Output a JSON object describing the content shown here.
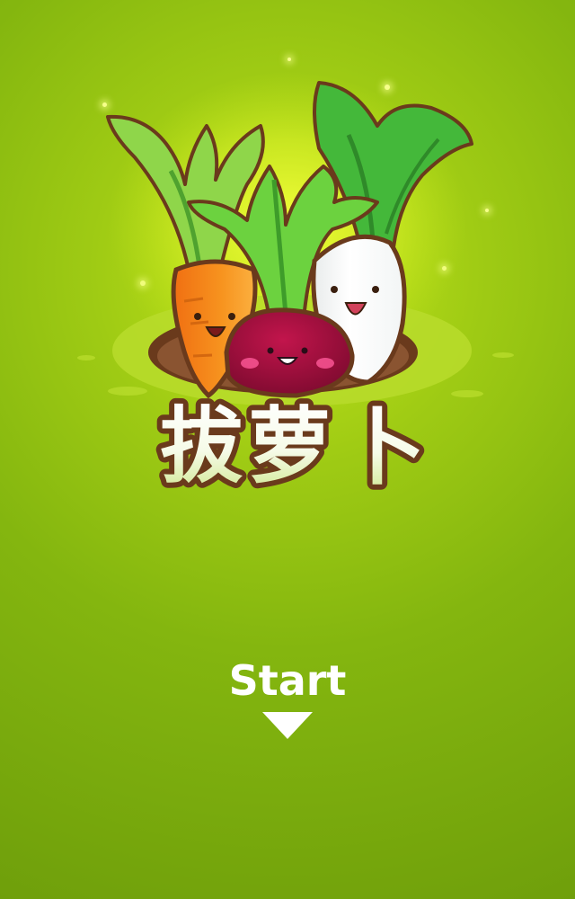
{
  "title": {
    "glyphs": [
      "拔",
      "萝",
      "卜"
    ]
  },
  "start": {
    "label": "Start",
    "arrow_icon": "triangle-down-icon"
  },
  "characters": [
    "carrot-character",
    "beet-character",
    "radish-character"
  ],
  "colors": {
    "background": "#8bbc12",
    "title_outline": "#6a3a1c",
    "title_fill": "#ffffff",
    "carrot": "#f7921d",
    "beet": "#a3103f",
    "radish": "#ffffff",
    "leaf": "#5ec73a"
  }
}
